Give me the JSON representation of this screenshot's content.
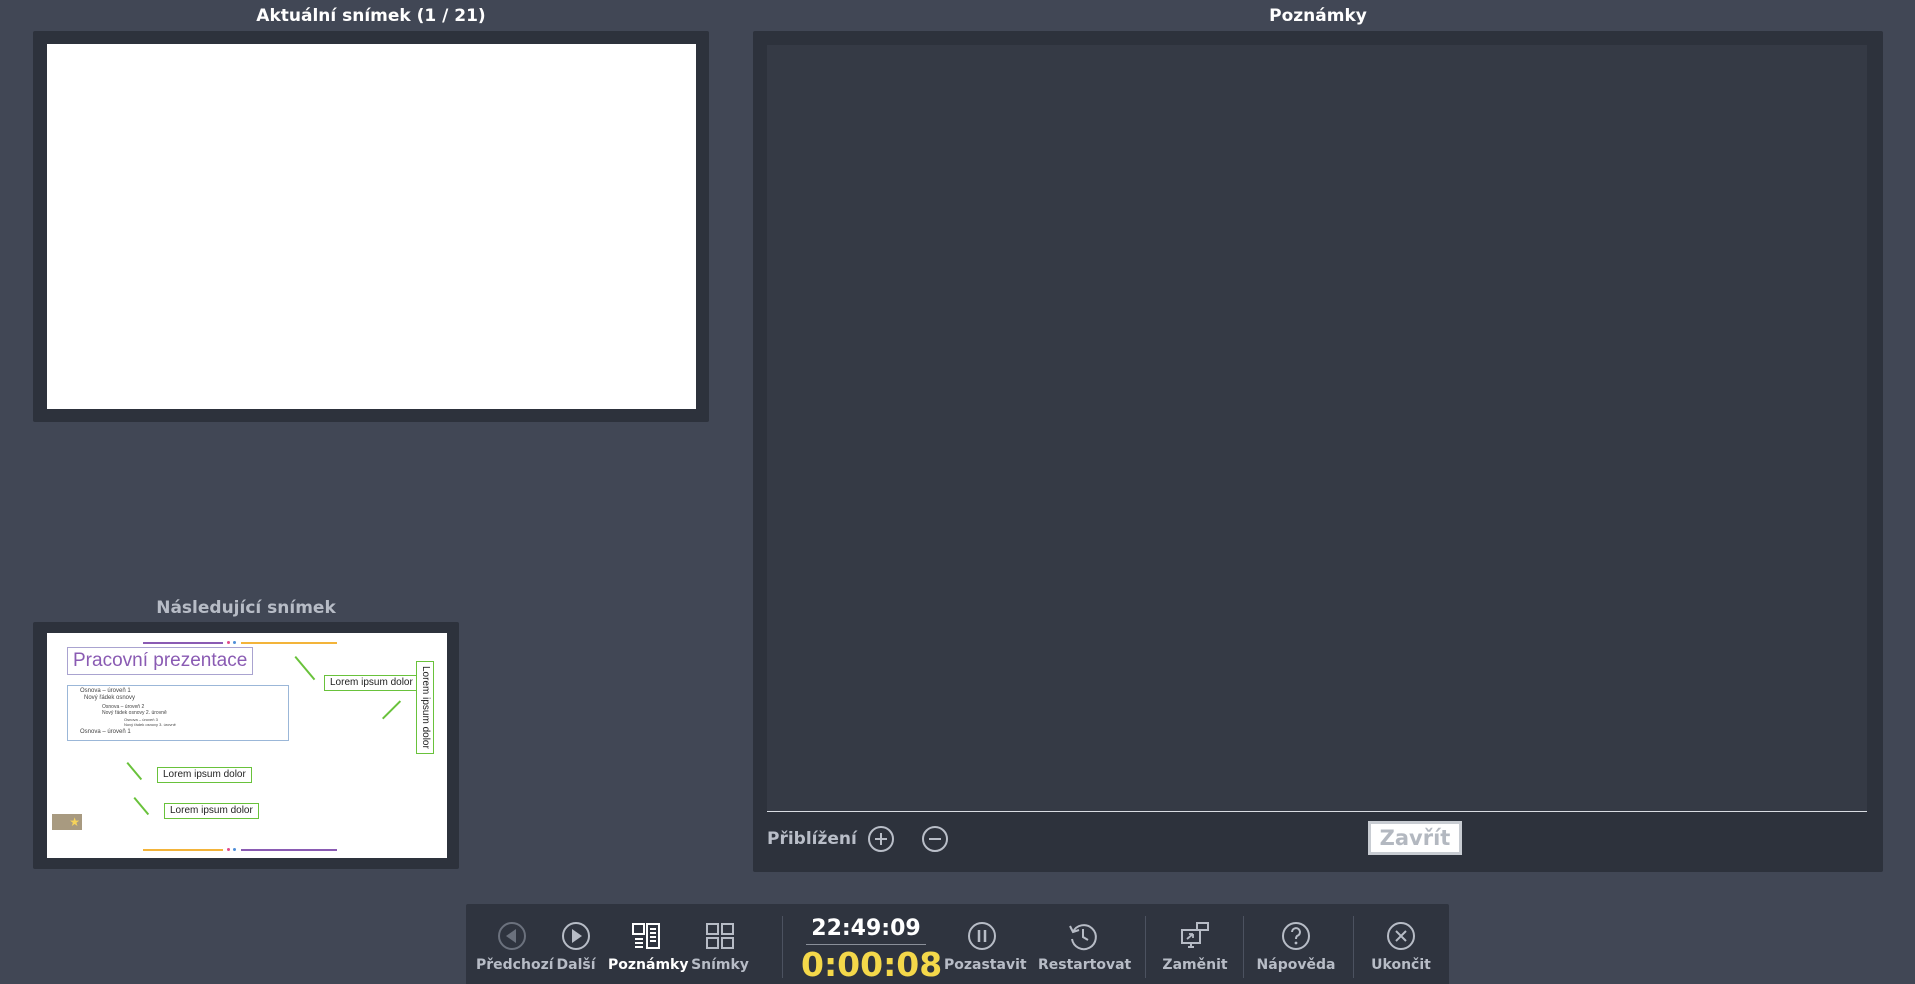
{
  "current_slide": {
    "heading": "Aktuální snímek (1 / 21)"
  },
  "next_slide": {
    "heading": "Následující snímek",
    "preview": {
      "title": "Pracovní prezentace",
      "outline": [
        "Osnova – úroveň 1",
        "Nový řádek osnovy",
        "Osnova – úroveň 2",
        "Nový řádek osnovy 2. úrovně",
        "Osnova – úroveň 3",
        "Nový řádek osnovy 3. úrovně",
        "Osnova – úroveň 1"
      ],
      "callouts": [
        "Lorem ipsum dolor",
        "Lorem ipsum dolor",
        "Lorem ipsum dolor",
        "Lorem ipsum dolor"
      ]
    }
  },
  "notes": {
    "heading": "Poznámky",
    "zoom_label": "Přiblížení",
    "close_label": "Zavřít"
  },
  "toolbar": {
    "previous": "Předchozí",
    "next": "Další",
    "notes": "Poznámky",
    "slides": "Snímky",
    "clock": "22:49:09",
    "elapsed": "0:00:08",
    "pause": "Pozastavit",
    "restart": "Restartovat",
    "swap": "Zaměnit",
    "help": "Nápověda",
    "exit": "Ukončit"
  },
  "colors": {
    "background": "#414755",
    "panel": "#2d323c",
    "timer": "#f4d84a",
    "callout_border": "#69c23b",
    "title_purple": "#8a5bb3"
  }
}
